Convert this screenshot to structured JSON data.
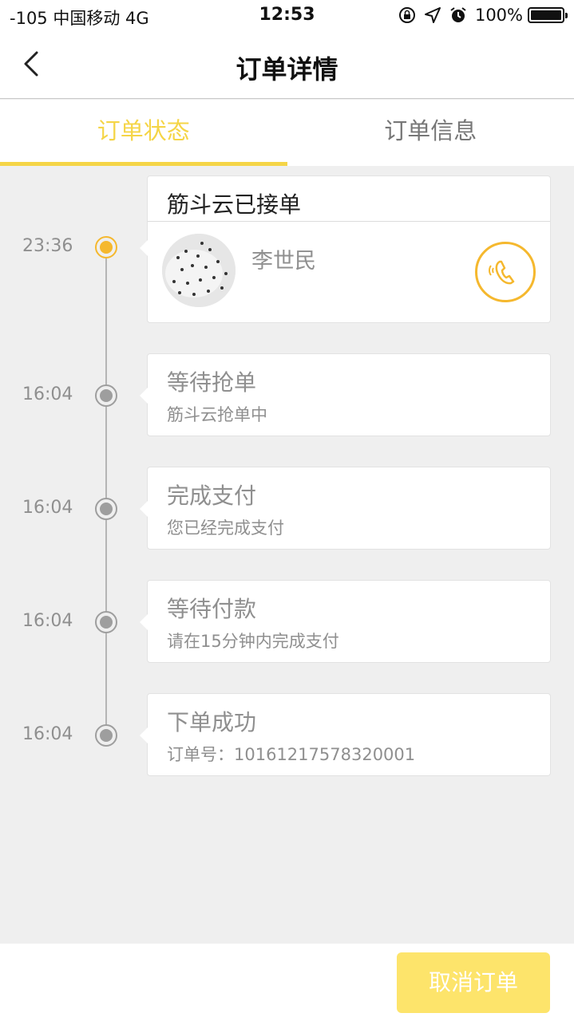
{
  "status_bar": {
    "carrier": "-105 中国移动   4G",
    "time": "12:53",
    "battery": "100%"
  },
  "nav": {
    "title": "订单详情"
  },
  "tabs": [
    {
      "label": "订单状态",
      "active": true
    },
    {
      "label": "订单信息",
      "active": false
    }
  ],
  "timeline": [
    {
      "time": "23:36",
      "title": "筋斗云已接单",
      "driver_name": "李世民",
      "active": true
    },
    {
      "time": "16:04",
      "title": "等待抢单",
      "subtitle": "筋斗云抢单中"
    },
    {
      "time": "16:04",
      "title": "完成支付",
      "subtitle": "您已经完成支付"
    },
    {
      "time": "16:04",
      "title": "等待付款",
      "subtitle": "请在15分钟内完成支付"
    },
    {
      "time": "16:04",
      "title": "下单成功",
      "subtitle": "订单号：10161217578320001"
    }
  ],
  "footer": {
    "cancel_label": "取消订单"
  },
  "colors": {
    "accent": "#f5d547",
    "active_dot": "#f5b82e",
    "button_bg": "#fde46b"
  },
  "icons": [
    "back-arrow-icon",
    "orientation-lock-icon",
    "location-icon",
    "alarm-icon",
    "battery-icon",
    "phone-icon"
  ]
}
